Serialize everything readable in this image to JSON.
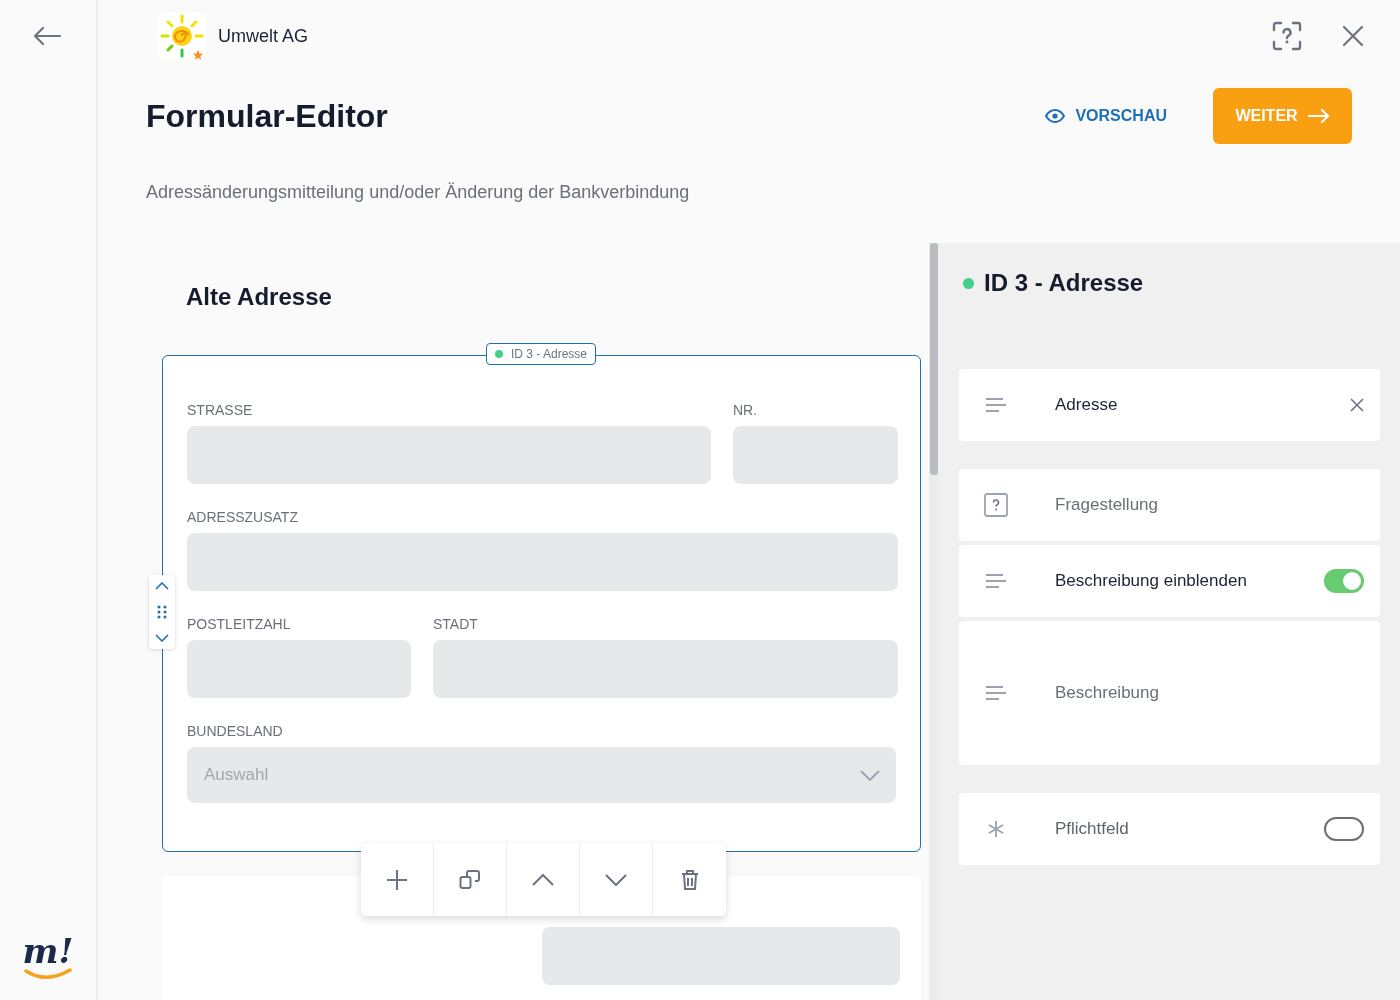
{
  "rail": {
    "logo_text": "m!"
  },
  "header": {
    "brand": "Umwelt AG",
    "title": "Formular-Editor",
    "preview_button": "VORSCHAU",
    "next_button": "WEITER",
    "subtitle": "Adressänderungsmitteilung und/oder Änderung der Bankverbindung"
  },
  "section": {
    "title": "Alte Adresse"
  },
  "block": {
    "badge": "ID 3 - Adresse",
    "rows": [
      {
        "kind": "split-end",
        "fields": [
          {
            "label": "STRASSE"
          },
          {
            "label": "NR."
          }
        ]
      },
      {
        "kind": "full",
        "fields": [
          {
            "label": "ADRESSZUSATZ"
          }
        ]
      },
      {
        "kind": "split-start",
        "fields": [
          {
            "label": "POSTLEITZAHL"
          },
          {
            "label": "STADT"
          }
        ]
      },
      {
        "kind": "select",
        "fields": [
          {
            "label": "BUNDESLAND",
            "placeholder": "Auswahl"
          }
        ]
      }
    ]
  },
  "panel": {
    "title": "ID 3 - Adresse",
    "items": [
      {
        "kind": "title-input",
        "value": "Adresse"
      },
      {
        "kind": "question-input",
        "placeholder": "Fragestellung"
      },
      {
        "kind": "toggle",
        "label": "Beschreibung einblenden",
        "on": true
      },
      {
        "kind": "textarea",
        "placeholder": "Beschreibung"
      },
      {
        "kind": "required-toggle",
        "label": "Pflichtfeld",
        "on": false
      }
    ]
  }
}
